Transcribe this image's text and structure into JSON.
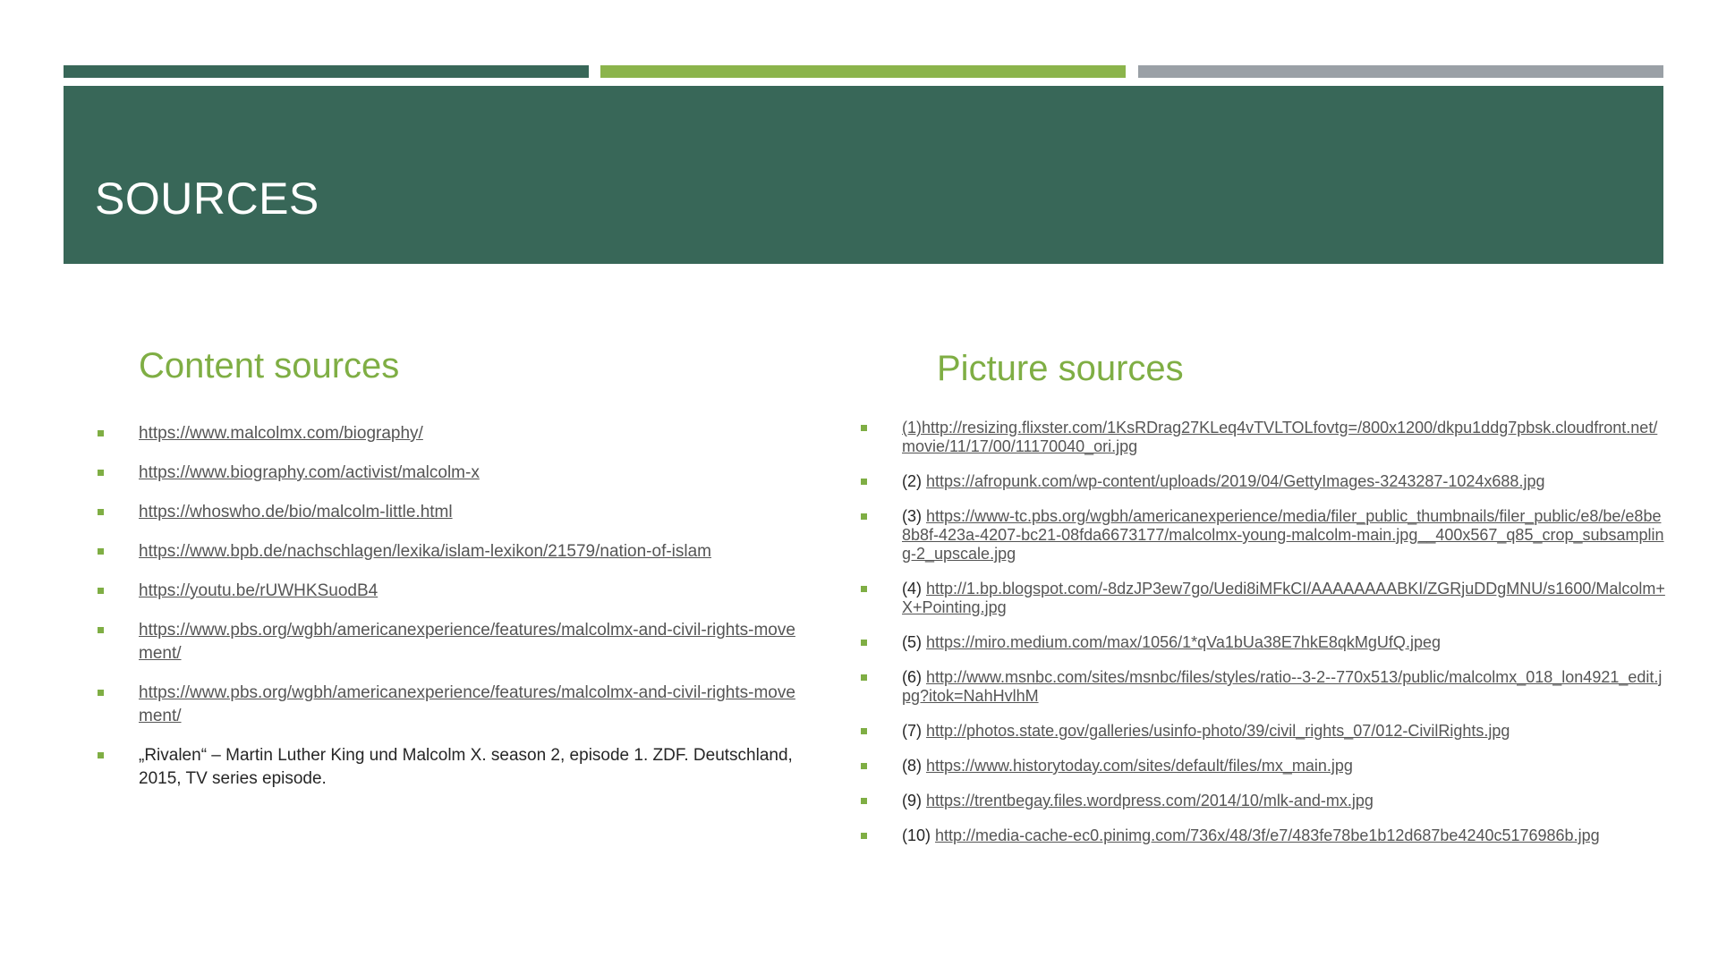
{
  "slide": {
    "title": "SOURCES",
    "accent_colors": {
      "dark_green": "#386758",
      "lime": "#8bb44b",
      "gray": "#9aa0a6"
    }
  },
  "content_sources": {
    "heading": "Content sources",
    "items": [
      "https://www.malcolmx.com/biography/",
      "https://www.biography.com/activist/malcolm-x",
      "https://whoswho.de/bio/malcolm-little.html",
      "https://www.bpb.de/nachschlagen/lexika/islam-lexikon/21579/nation-of-islam",
      "https://youtu.be/rUWHKSuodB4",
      "https://www.pbs.org/wgbh/americanexperience/features/malcolmx-and-civil-rights-movement/",
      "https://www.pbs.org/wgbh/americanexperience/features/malcolmx-and-civil-rights-movement/"
    ],
    "citation": "„Rivalen“ – Martin Luther King und Malcolm X. season 2, episode 1. ZDF. Deutschland, 2015, TV series episode."
  },
  "picture_sources": {
    "heading": "Picture sources",
    "items": [
      {
        "num": "",
        "link": "(1)http://resizing.flixster.com/1KsRDrag27KLeq4vTVLTOLfovtg=/800x1200/dkpu1ddg7pbsk.cloudfront.net/movie/11/17/00/11170040_ori.jpg"
      },
      {
        "num": "(2)",
        "link": "https://afropunk.com/wp-content/uploads/2019/04/GettyImages-3243287-1024x688.jpg"
      },
      {
        "num": "(3)",
        "link": "https://www-tc.pbs.org/wgbh/americanexperience/media/filer_public_thumbnails/filer_public/e8/be/e8be8b8f-423a-4207-bc21-08fda6673177/malcolmx-young-malcolm-main.jpg__400x567_q85_crop_subsampling-2_upscale.jpg"
      },
      {
        "num": "(4)",
        "link": "http://1.bp.blogspot.com/-8dzJP3ew7go/Uedi8iMFkCI/AAAAAAAABKI/ZGRjuDDgMNU/s1600/Malcolm+X+Pointing.jpg"
      },
      {
        "num": "(5)",
        "link": "https://miro.medium.com/max/1056/1*qVa1bUa38E7hkE8qkMgUfQ.jpeg"
      },
      {
        "num": "(6)",
        "link": "http://www.msnbc.com/sites/msnbc/files/styles/ratio--3-2--770x513/public/malcolmx_018_lon4921_edit.jpg?itok=NahHvlhM"
      },
      {
        "num": "(7)",
        "link": "http://photos.state.gov/galleries/usinfo-photo/39/civil_rights_07/012-CivilRights.jpg"
      },
      {
        "num": "(8)",
        "link": "https://www.historytoday.com/sites/default/files/mx_main.jpg"
      },
      {
        "num": "(9)",
        "link": "https://trentbegay.files.wordpress.com/2014/10/mlk-and-mx.jpg"
      },
      {
        "num": "(10)",
        "link": "http://media-cache-ec0.pinimg.com/736x/48/3f/e7/483fe78be1b12d687be4240c5176986b.jpg"
      }
    ]
  }
}
